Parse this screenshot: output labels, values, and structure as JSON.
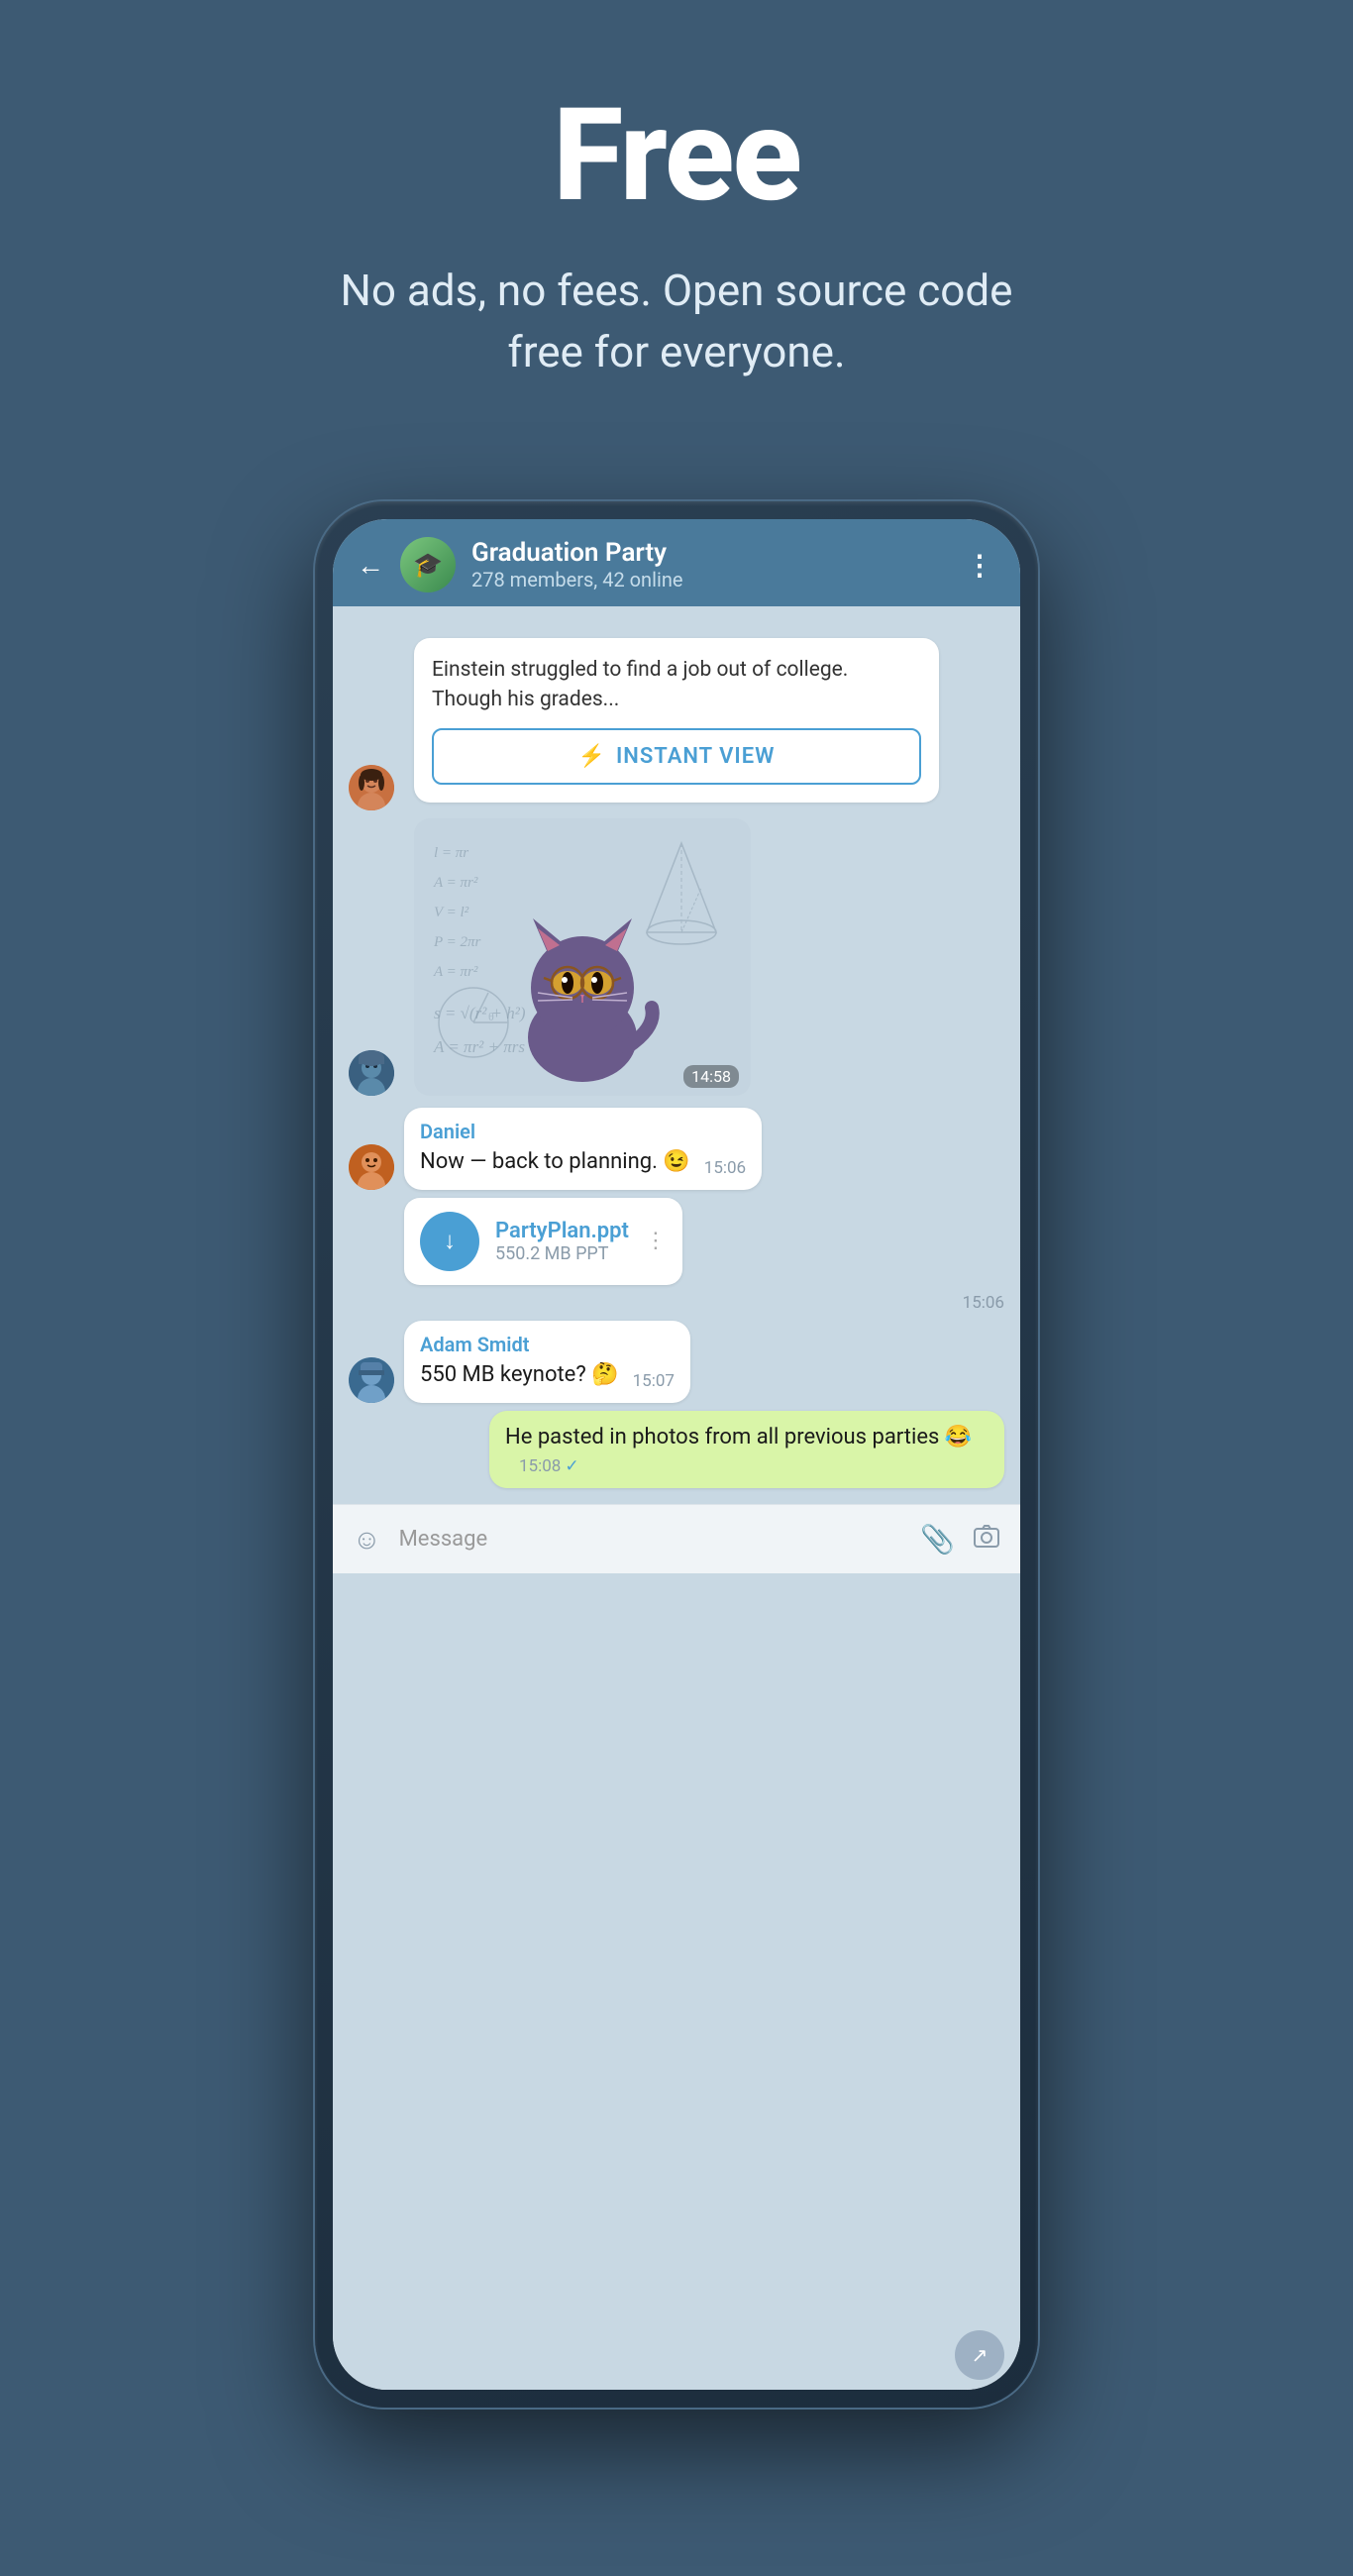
{
  "hero": {
    "title": "Free",
    "subtitle": "No ads, no fees. Open source code free for everyone."
  },
  "phone": {
    "header": {
      "back_label": "←",
      "chat_name": "Graduation Party",
      "chat_members": "278 members, 42 online",
      "menu_icon": "⋮"
    },
    "messages": [
      {
        "id": "link-preview",
        "type": "link_preview",
        "avatar_type": "female",
        "link_text": "Einstein struggled to find a job out of college. Though his grades...",
        "instant_view_label": "INSTANT VIEW",
        "lightning_icon": "⚡"
      },
      {
        "id": "sticker-msg",
        "type": "sticker",
        "avatar_type": "male1",
        "time": "14:58"
      },
      {
        "id": "msg-daniel",
        "type": "text",
        "sender": "Daniel",
        "text": "Now — back to planning. 😉",
        "time": "15:06",
        "avatar_type": "male2"
      },
      {
        "id": "msg-file",
        "type": "file",
        "file_name": "PartyPlan.ppt",
        "file_size": "550.2 MB PPT",
        "time": "15:06",
        "avatar_type": "male2"
      },
      {
        "id": "msg-adam",
        "type": "text",
        "sender": "Adam Smidt",
        "text": "550 MB keynote? 🤔",
        "time": "15:07",
        "avatar_type": "male3"
      },
      {
        "id": "msg-outgoing",
        "type": "text_outgoing",
        "text": "He pasted in photos from all previous parties 😂",
        "time": "15:08",
        "checkmark": "✓"
      }
    ],
    "input_bar": {
      "placeholder": "Message",
      "emoji_icon": "☺",
      "attach_icon": "📎",
      "camera_icon": "⊙"
    }
  }
}
